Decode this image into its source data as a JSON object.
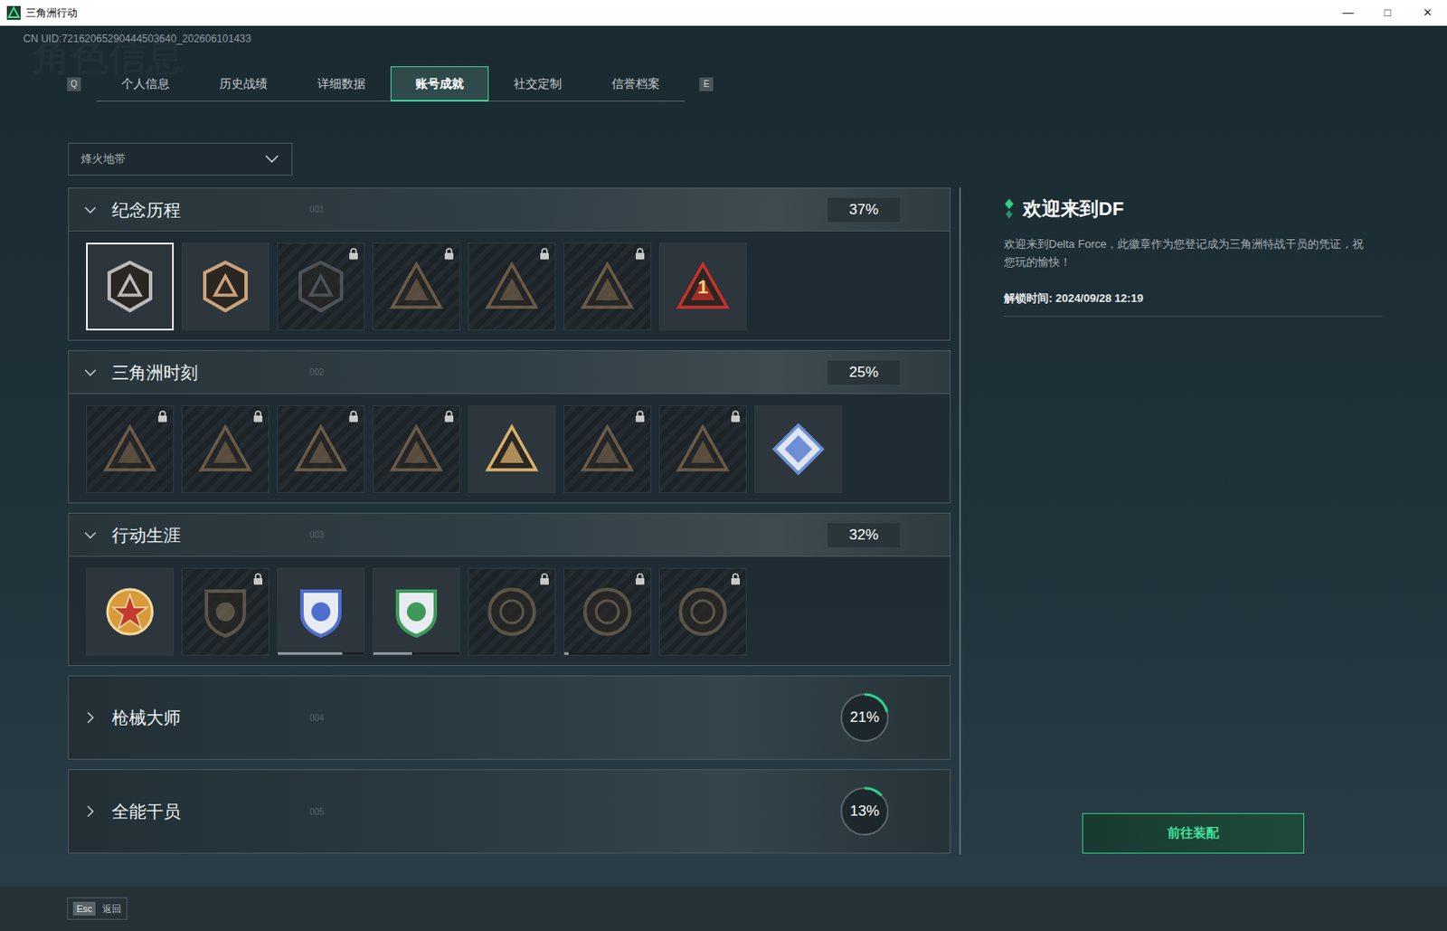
{
  "window": {
    "title": "三角洲行动",
    "controls": [
      "—",
      "□",
      "✕"
    ]
  },
  "uid": "CN UID:72162065290444503640_202606101433",
  "watermark": "角色信息",
  "tabs": {
    "prev_key": "Q",
    "next_key": "E",
    "items": [
      {
        "label": "个人信息",
        "selected": false
      },
      {
        "label": "历史战绩",
        "selected": false
      },
      {
        "label": "详细数据",
        "selected": false
      },
      {
        "label": "账号成就",
        "selected": true
      },
      {
        "label": "社交定制",
        "selected": false
      },
      {
        "label": "信誉档案",
        "selected": false
      }
    ]
  },
  "mode_dropdown": {
    "value": "烽火地带"
  },
  "sections": [
    {
      "title": "纪念历程",
      "index": "001",
      "percent": "37%",
      "expanded": true,
      "badges": [
        {
          "kind": "hexagon",
          "color": "#b9b9b9",
          "locked": false,
          "selected": true
        },
        {
          "kind": "hexagon",
          "color": "#c9a27a",
          "locked": false,
          "selected": false
        },
        {
          "kind": "hexagon",
          "color": "#70777c",
          "locked": true,
          "selected": false
        },
        {
          "kind": "triangle",
          "color": "#a8865f",
          "locked": true,
          "selected": false
        },
        {
          "kind": "triangle",
          "color": "#a8865f",
          "locked": true,
          "selected": false
        },
        {
          "kind": "triangle",
          "color": "#a8865f",
          "locked": true,
          "selected": false
        },
        {
          "kind": "triangle",
          "color": "#c9302c",
          "locked": false,
          "selected": false,
          "mark": "1"
        }
      ]
    },
    {
      "title": "三角洲时刻",
      "index": "002",
      "percent": "25%",
      "expanded": true,
      "badges": [
        {
          "kind": "triangle",
          "color": "#a8865f",
          "locked": true,
          "selected": false
        },
        {
          "kind": "triangle",
          "color": "#a8865f",
          "locked": true,
          "selected": false
        },
        {
          "kind": "triangle",
          "color": "#a8865f",
          "locked": true,
          "selected": false
        },
        {
          "kind": "triangle",
          "color": "#a8865f",
          "locked": true,
          "selected": false
        },
        {
          "kind": "triangle",
          "color": "#d9b06a",
          "locked": false,
          "selected": false
        },
        {
          "kind": "triangle",
          "color": "#a8865f",
          "locked": true,
          "selected": false
        },
        {
          "kind": "triangle",
          "color": "#a8865f",
          "locked": true,
          "selected": false
        },
        {
          "kind": "diamond",
          "color": "#6d8fd6",
          "locked": false,
          "selected": false
        }
      ]
    },
    {
      "title": "行动生涯",
      "index": "003",
      "percent": "32%",
      "expanded": true,
      "badges": [
        {
          "kind": "medal",
          "color": "#d99a3a",
          "locked": false,
          "selected": false
        },
        {
          "kind": "shield",
          "color": "#8a7a5c",
          "locked": true,
          "selected": false
        },
        {
          "kind": "shield",
          "color": "#4f6fd0",
          "locked": false,
          "selected": false,
          "progress": 0.75
        },
        {
          "kind": "shield",
          "color": "#3f9a5a",
          "locked": false,
          "selected": false,
          "progress": 0.45
        },
        {
          "kind": "round",
          "color": "#8a7a5c",
          "locked": true,
          "selected": false
        },
        {
          "kind": "round",
          "color": "#8a7a5c",
          "locked": true,
          "selected": false,
          "progress": 0.05
        },
        {
          "kind": "round",
          "color": "#8a7a5c",
          "locked": true,
          "selected": false
        }
      ]
    },
    {
      "title": "枪械大师",
      "index": "004",
      "percent": "21%",
      "expanded": false,
      "level": 0.21
    },
    {
      "title": "全能干员",
      "index": "005",
      "percent": "13%",
      "expanded": false,
      "level": 0.13
    }
  ],
  "detail": {
    "title": "欢迎来到DF",
    "description": "欢迎来到Delta Force，此徽章作为您登记成为三角洲特战干员的凭证，祝您玩的愉快！",
    "unlock_time": "解锁时间: 2024/09/28 12:19",
    "button": "前往装配"
  },
  "footer": {
    "key": "Esc",
    "label": "返回"
  }
}
